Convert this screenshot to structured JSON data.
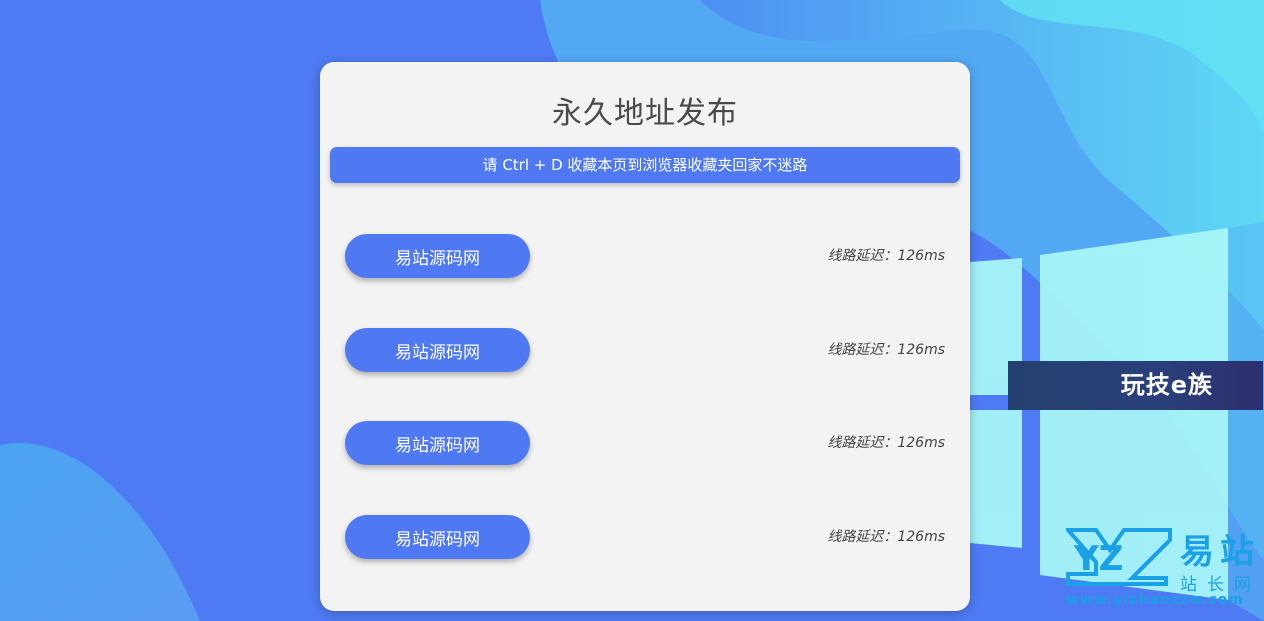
{
  "title": "永久地址发布",
  "notice": "请 Ctrl + D 收藏本页到浏览器收藏夹回家不迷路",
  "rows": [
    {
      "button_label": "易站源码网",
      "latency": "线路延迟：126ms"
    },
    {
      "button_label": "易站源码网",
      "latency": "线路延迟：126ms"
    },
    {
      "button_label": "易站源码网",
      "latency": "线路延迟：126ms"
    },
    {
      "button_label": "易站源码网",
      "latency": "线路延迟：126ms"
    }
  ],
  "banner": {
    "text": "玩技e族"
  },
  "logo": {
    "mark": "YZ",
    "cn": "易站",
    "sub": "站长网",
    "url": "www.yizhanzzw.com"
  },
  "colors": {
    "accent": "#4f79f3",
    "card_bg": "#f3f3f3",
    "logo": "#1aa0e6"
  }
}
